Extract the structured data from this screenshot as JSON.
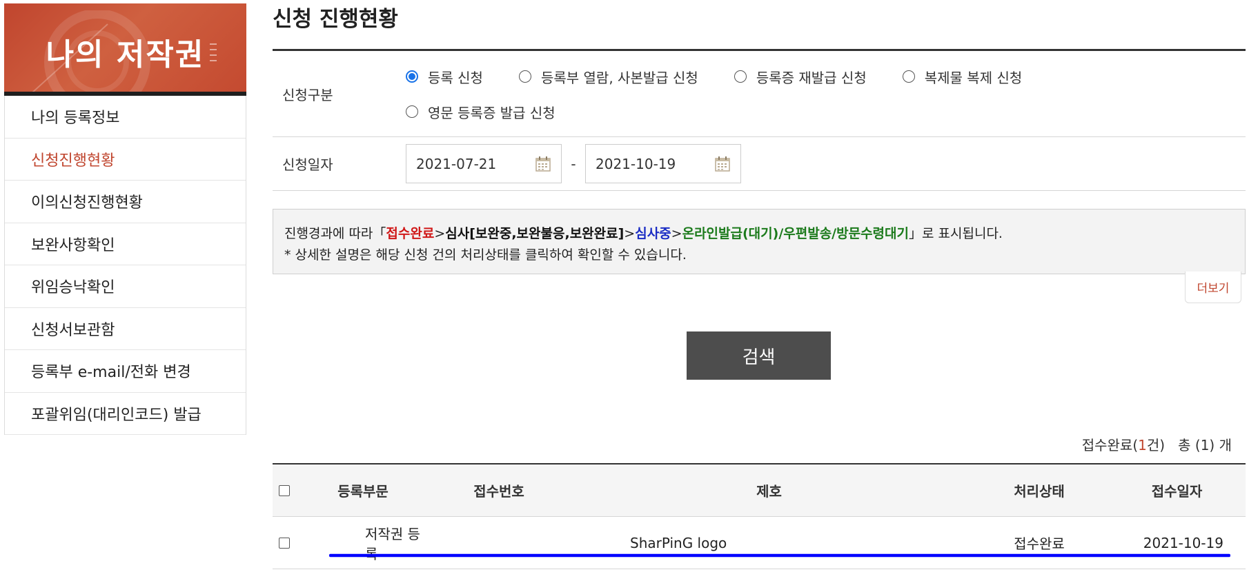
{
  "sidebar": {
    "banner_title": "나의 저작권",
    "items": [
      {
        "label": "나의 등록정보",
        "active": false
      },
      {
        "label": "신청진행현황",
        "active": true
      },
      {
        "label": "이의신청진행현황",
        "active": false
      },
      {
        "label": "보완사항확인",
        "active": false
      },
      {
        "label": "위임승낙확인",
        "active": false
      },
      {
        "label": "신청서보관함",
        "active": false
      },
      {
        "label": "등록부 e-mail/전화 변경",
        "active": false
      },
      {
        "label": "포괄위임(대리인코드) 발급",
        "active": false
      }
    ]
  },
  "page": {
    "title": "신청 진행현황"
  },
  "form": {
    "type_label": "신청구분",
    "options": [
      {
        "label": "등록 신청",
        "checked": true
      },
      {
        "label": "등록부 열람, 사본발급 신청",
        "checked": false
      },
      {
        "label": "등록증 재발급 신청",
        "checked": false
      },
      {
        "label": "복제물 복제 신청",
        "checked": false
      },
      {
        "label": "영문 등록증 발급 신청",
        "checked": false
      }
    ],
    "date_label": "신청일자",
    "date_from": "2021-07-21",
    "date_sep": "-",
    "date_to": "2021-10-19"
  },
  "notice": {
    "line1_prefix": "진행경과에 따라「",
    "s_received": "접수완료",
    "gt1": ">",
    "s_review": "심사[보완중,보완불응,보완완료]",
    "gt2": ">",
    "s_reviewing": "심사중",
    "gt3": ">",
    "s_issue": "온라인발급(대기)/우편발송/방문수령대기",
    "line1_suffix": "」로 표시됩니다.",
    "line2": "* 상세한 설명은 해당 신청 건의 처리상태를 클릭하여 확인할 수 있습니다."
  },
  "more_label": "더보기",
  "search_label": "검색",
  "summary": {
    "prefix": "접수완료(",
    "count": "1",
    "suffix": "건)   총 (1) 개"
  },
  "table": {
    "headers": {
      "dept": "등록부문",
      "no": "접수번호",
      "title": "제호",
      "status": "처리상태",
      "date": "접수일자"
    },
    "rows": [
      {
        "dept": "저작권 등록",
        "no": "",
        "title": "SharPinG logo",
        "status": "접수완료",
        "date": "2021-10-19"
      }
    ]
  },
  "colors": {
    "accent": "#c0452e",
    "radio": "#1a73e8",
    "underline": "#0000ff"
  }
}
